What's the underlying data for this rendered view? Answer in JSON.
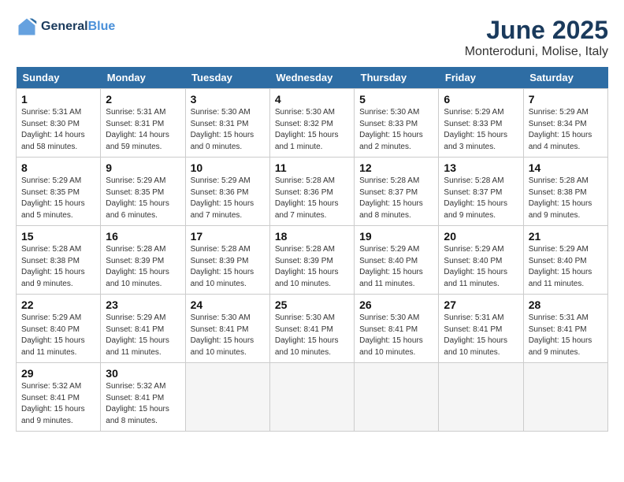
{
  "header": {
    "logo_line1": "General",
    "logo_line2": "Blue",
    "month": "June 2025",
    "location": "Monteroduni, Molise, Italy"
  },
  "weekdays": [
    "Sunday",
    "Monday",
    "Tuesday",
    "Wednesday",
    "Thursday",
    "Friday",
    "Saturday"
  ],
  "weeks": [
    [
      {
        "day": "1",
        "info": "Sunrise: 5:31 AM\nSunset: 8:30 PM\nDaylight: 14 hours\nand 58 minutes."
      },
      {
        "day": "2",
        "info": "Sunrise: 5:31 AM\nSunset: 8:31 PM\nDaylight: 14 hours\nand 59 minutes."
      },
      {
        "day": "3",
        "info": "Sunrise: 5:30 AM\nSunset: 8:31 PM\nDaylight: 15 hours\nand 0 minutes."
      },
      {
        "day": "4",
        "info": "Sunrise: 5:30 AM\nSunset: 8:32 PM\nDaylight: 15 hours\nand 1 minute."
      },
      {
        "day": "5",
        "info": "Sunrise: 5:30 AM\nSunset: 8:33 PM\nDaylight: 15 hours\nand 2 minutes."
      },
      {
        "day": "6",
        "info": "Sunrise: 5:29 AM\nSunset: 8:33 PM\nDaylight: 15 hours\nand 3 minutes."
      },
      {
        "day": "7",
        "info": "Sunrise: 5:29 AM\nSunset: 8:34 PM\nDaylight: 15 hours\nand 4 minutes."
      }
    ],
    [
      {
        "day": "8",
        "info": "Sunrise: 5:29 AM\nSunset: 8:35 PM\nDaylight: 15 hours\nand 5 minutes."
      },
      {
        "day": "9",
        "info": "Sunrise: 5:29 AM\nSunset: 8:35 PM\nDaylight: 15 hours\nand 6 minutes."
      },
      {
        "day": "10",
        "info": "Sunrise: 5:29 AM\nSunset: 8:36 PM\nDaylight: 15 hours\nand 7 minutes."
      },
      {
        "day": "11",
        "info": "Sunrise: 5:28 AM\nSunset: 8:36 PM\nDaylight: 15 hours\nand 7 minutes."
      },
      {
        "day": "12",
        "info": "Sunrise: 5:28 AM\nSunset: 8:37 PM\nDaylight: 15 hours\nand 8 minutes."
      },
      {
        "day": "13",
        "info": "Sunrise: 5:28 AM\nSunset: 8:37 PM\nDaylight: 15 hours\nand 9 minutes."
      },
      {
        "day": "14",
        "info": "Sunrise: 5:28 AM\nSunset: 8:38 PM\nDaylight: 15 hours\nand 9 minutes."
      }
    ],
    [
      {
        "day": "15",
        "info": "Sunrise: 5:28 AM\nSunset: 8:38 PM\nDaylight: 15 hours\nand 9 minutes."
      },
      {
        "day": "16",
        "info": "Sunrise: 5:28 AM\nSunset: 8:39 PM\nDaylight: 15 hours\nand 10 minutes."
      },
      {
        "day": "17",
        "info": "Sunrise: 5:28 AM\nSunset: 8:39 PM\nDaylight: 15 hours\nand 10 minutes."
      },
      {
        "day": "18",
        "info": "Sunrise: 5:28 AM\nSunset: 8:39 PM\nDaylight: 15 hours\nand 10 minutes."
      },
      {
        "day": "19",
        "info": "Sunrise: 5:29 AM\nSunset: 8:40 PM\nDaylight: 15 hours\nand 11 minutes."
      },
      {
        "day": "20",
        "info": "Sunrise: 5:29 AM\nSunset: 8:40 PM\nDaylight: 15 hours\nand 11 minutes."
      },
      {
        "day": "21",
        "info": "Sunrise: 5:29 AM\nSunset: 8:40 PM\nDaylight: 15 hours\nand 11 minutes."
      }
    ],
    [
      {
        "day": "22",
        "info": "Sunrise: 5:29 AM\nSunset: 8:40 PM\nDaylight: 15 hours\nand 11 minutes."
      },
      {
        "day": "23",
        "info": "Sunrise: 5:29 AM\nSunset: 8:41 PM\nDaylight: 15 hours\nand 11 minutes."
      },
      {
        "day": "24",
        "info": "Sunrise: 5:30 AM\nSunset: 8:41 PM\nDaylight: 15 hours\nand 10 minutes."
      },
      {
        "day": "25",
        "info": "Sunrise: 5:30 AM\nSunset: 8:41 PM\nDaylight: 15 hours\nand 10 minutes."
      },
      {
        "day": "26",
        "info": "Sunrise: 5:30 AM\nSunset: 8:41 PM\nDaylight: 15 hours\nand 10 minutes."
      },
      {
        "day": "27",
        "info": "Sunrise: 5:31 AM\nSunset: 8:41 PM\nDaylight: 15 hours\nand 10 minutes."
      },
      {
        "day": "28",
        "info": "Sunrise: 5:31 AM\nSunset: 8:41 PM\nDaylight: 15 hours\nand 9 minutes."
      }
    ],
    [
      {
        "day": "29",
        "info": "Sunrise: 5:32 AM\nSunset: 8:41 PM\nDaylight: 15 hours\nand 9 minutes."
      },
      {
        "day": "30",
        "info": "Sunrise: 5:32 AM\nSunset: 8:41 PM\nDaylight: 15 hours\nand 8 minutes."
      },
      null,
      null,
      null,
      null,
      null
    ]
  ]
}
